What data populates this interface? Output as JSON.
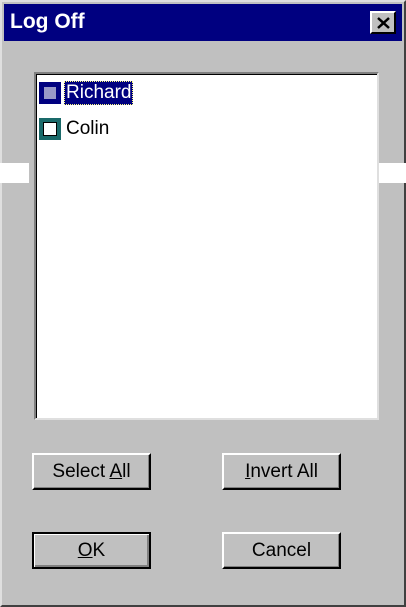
{
  "window": {
    "title": "Log Off"
  },
  "title_bar": {
    "close_icon": "close-x-icon"
  },
  "users_list": {
    "items": [
      {
        "label": "Richard",
        "selected": true
      },
      {
        "label": "Colin",
        "selected": false
      }
    ]
  },
  "buttons": {
    "select_all": {
      "before": "Select ",
      "mnemonic": "A",
      "after": "ll"
    },
    "invert_all": {
      "before": "",
      "mnemonic": "I",
      "after": "nvert All"
    },
    "ok": {
      "before": "",
      "mnemonic": "O",
      "after": "K"
    },
    "cancel": {
      "label": "Cancel"
    }
  },
  "colors": {
    "title_bar": "#000080",
    "face": "#c0c0c0",
    "selection": "#000080"
  }
}
